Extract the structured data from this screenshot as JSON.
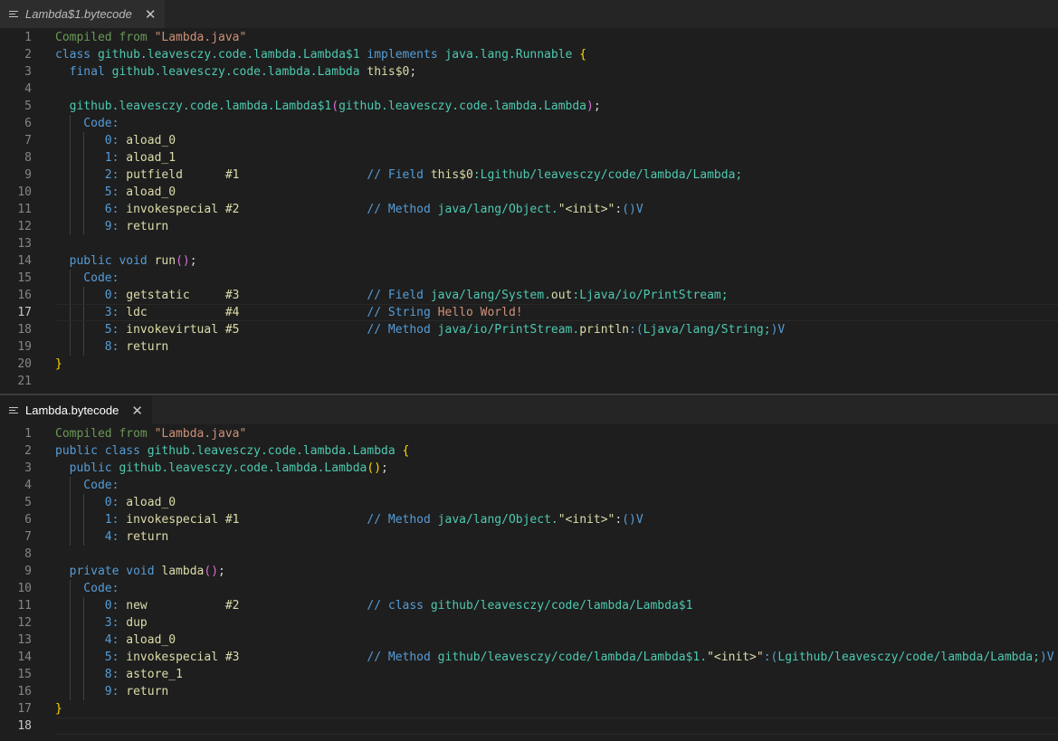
{
  "editor1": {
    "tab_label": "Lambda$1.bytecode",
    "lines": [
      [
        [
          "Compiled from ",
          "t-comment"
        ],
        [
          "\"Lambda.java\"",
          "t-string"
        ]
      ],
      [
        [
          "class ",
          "t-keyword"
        ],
        [
          "github.leavesczy.code.lambda.Lambda$1",
          "t-type"
        ],
        [
          " implements ",
          "t-keyword"
        ],
        [
          "java.lang.Runnable",
          "t-type"
        ],
        [
          " {",
          "t-brace"
        ]
      ],
      [
        [
          "  final ",
          "t-keyword"
        ],
        [
          "github.leavesczy.code.lambda.Lambda",
          "t-type"
        ],
        [
          " this$0",
          "t-fn"
        ],
        [
          ";",
          "t-plain"
        ]
      ],
      [],
      [
        [
          "  github.leavesczy.code.lambda.Lambda$1",
          "t-type"
        ],
        [
          "(",
          "t-paren"
        ],
        [
          "github.leavesczy.code.lambda.Lambda",
          "t-type"
        ],
        [
          ")",
          "t-paren"
        ],
        [
          ";",
          "t-plain"
        ]
      ],
      [
        [
          "    Code:",
          "t-keyword"
        ]
      ],
      [
        [
          "       0: ",
          "t-label"
        ],
        [
          "aload_0",
          "t-fn"
        ]
      ],
      [
        [
          "       1: ",
          "t-label"
        ],
        [
          "aload_1",
          "t-fn"
        ]
      ],
      [
        [
          "       2: ",
          "t-label"
        ],
        [
          "putfield      #1                  ",
          "t-fn"
        ],
        [
          "// Field ",
          "t-keyword"
        ],
        [
          "this$0",
          "t-fn"
        ],
        [
          ":Lgithub/leavesczy/code/lambda/Lambda;",
          "t-type"
        ]
      ],
      [
        [
          "       5: ",
          "t-label"
        ],
        [
          "aload_0",
          "t-fn"
        ]
      ],
      [
        [
          "       6: ",
          "t-label"
        ],
        [
          "invokespecial #2                  ",
          "t-fn"
        ],
        [
          "// Method ",
          "t-keyword"
        ],
        [
          "java/lang/Object.",
          "t-type"
        ],
        [
          "\"<init>\"",
          "t-fn"
        ],
        [
          ":",
          "t-plain"
        ],
        [
          "()",
          "t-keyword"
        ],
        [
          "V",
          "t-keyword"
        ]
      ],
      [
        [
          "       9: ",
          "t-label"
        ],
        [
          "return",
          "t-fn"
        ]
      ],
      [],
      [
        [
          "  public void ",
          "t-keyword"
        ],
        [
          "run",
          "t-fn"
        ],
        [
          "()",
          "t-paren"
        ],
        [
          ";",
          "t-plain"
        ]
      ],
      [
        [
          "    Code:",
          "t-keyword"
        ]
      ],
      [
        [
          "       0: ",
          "t-label"
        ],
        [
          "getstatic     #3                  ",
          "t-fn"
        ],
        [
          "// Field ",
          "t-keyword"
        ],
        [
          "java/lang/System.",
          "t-type"
        ],
        [
          "out",
          "t-fn"
        ],
        [
          ":Ljava/io/PrintStream;",
          "t-type"
        ]
      ],
      [
        [
          "       3: ",
          "t-label"
        ],
        [
          "ldc           #4                  ",
          "t-fn"
        ],
        [
          "// String ",
          "t-keyword"
        ],
        [
          "Hello World!",
          "t-string"
        ]
      ],
      [
        [
          "       5: ",
          "t-label"
        ],
        [
          "invokevirtual #5                  ",
          "t-fn"
        ],
        [
          "// Method ",
          "t-keyword"
        ],
        [
          "java/io/PrintStream.",
          "t-type"
        ],
        [
          "println",
          "t-fn"
        ],
        [
          ":(",
          "t-keyword"
        ],
        [
          "Ljava/lang/String;",
          "t-type"
        ],
        [
          ")V",
          "t-keyword"
        ]
      ],
      [
        [
          "       8: ",
          "t-label"
        ],
        [
          "return",
          "t-fn"
        ]
      ],
      [
        [
          "}",
          "t-brace"
        ]
      ],
      []
    ],
    "active_line": 17
  },
  "editor2": {
    "tab_label": "Lambda.bytecode",
    "lines": [
      [
        [
          "Compiled from ",
          "t-comment"
        ],
        [
          "\"Lambda.java\"",
          "t-string"
        ]
      ],
      [
        [
          "public class ",
          "t-keyword"
        ],
        [
          "github.leavesczy.code.lambda.Lambda",
          "t-type"
        ],
        [
          " {",
          "t-brace"
        ]
      ],
      [
        [
          "  public ",
          "t-keyword"
        ],
        [
          "github.leavesczy.code.lambda.Lambda",
          "t-type"
        ],
        [
          "()",
          "t-brace"
        ],
        [
          ";",
          "t-plain"
        ]
      ],
      [
        [
          "    Code:",
          "t-keyword"
        ]
      ],
      [
        [
          "       0: ",
          "t-label"
        ],
        [
          "aload_0",
          "t-fn"
        ]
      ],
      [
        [
          "       1: ",
          "t-label"
        ],
        [
          "invokespecial #1                  ",
          "t-fn"
        ],
        [
          "// Method ",
          "t-keyword"
        ],
        [
          "java/lang/Object.",
          "t-type"
        ],
        [
          "\"<init>\"",
          "t-fn"
        ],
        [
          ":",
          "t-plain"
        ],
        [
          "()",
          "t-keyword"
        ],
        [
          "V",
          "t-keyword"
        ]
      ],
      [
        [
          "       4: ",
          "t-label"
        ],
        [
          "return",
          "t-fn"
        ]
      ],
      [],
      [
        [
          "  private void ",
          "t-keyword"
        ],
        [
          "lambda",
          "t-fn"
        ],
        [
          "()",
          "t-paren"
        ],
        [
          ";",
          "t-plain"
        ]
      ],
      [
        [
          "    Code:",
          "t-keyword"
        ]
      ],
      [
        [
          "       0: ",
          "t-label"
        ],
        [
          "new           #2                  ",
          "t-fn"
        ],
        [
          "// class ",
          "t-keyword"
        ],
        [
          "github/leavesczy/code/lambda/Lambda$1",
          "t-type"
        ]
      ],
      [
        [
          "       3: ",
          "t-label"
        ],
        [
          "dup",
          "t-fn"
        ]
      ],
      [
        [
          "       4: ",
          "t-label"
        ],
        [
          "aload_0",
          "t-fn"
        ]
      ],
      [
        [
          "       5: ",
          "t-label"
        ],
        [
          "invokespecial #3                  ",
          "t-fn"
        ],
        [
          "// Method ",
          "t-keyword"
        ],
        [
          "github/leavesczy/code/lambda/Lambda$1.",
          "t-type"
        ],
        [
          "\"<init>\"",
          "t-fn"
        ],
        [
          ":(",
          "t-keyword"
        ],
        [
          "Lgithub/leavesczy/code/lambda/Lambda;",
          "t-type"
        ],
        [
          ")V",
          "t-keyword"
        ]
      ],
      [
        [
          "       8: ",
          "t-label"
        ],
        [
          "astore_1",
          "t-fn"
        ]
      ],
      [
        [
          "       9: ",
          "t-label"
        ],
        [
          "return",
          "t-fn"
        ]
      ],
      [
        [
          "}",
          "t-brace"
        ]
      ],
      []
    ],
    "active_line": 18
  }
}
